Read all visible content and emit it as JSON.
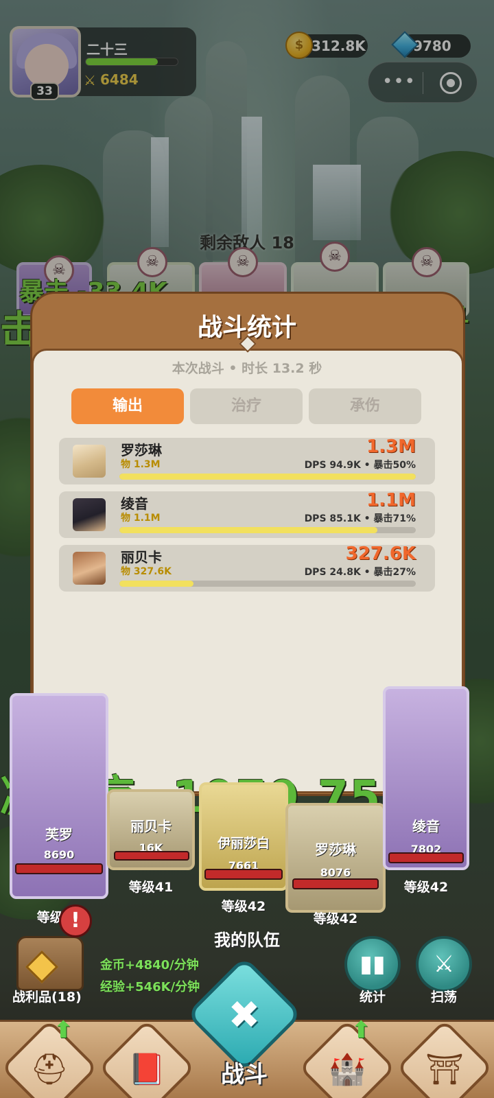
{
  "player": {
    "name": "二十三",
    "level": "33",
    "xp_fraction": 0.78,
    "power": "6484"
  },
  "currency": {
    "gold": "312.8K",
    "gems": "9780"
  },
  "battle": {
    "enemies_remaining": "剩余敌人 18",
    "float_crit": "暴击 -33.4K",
    "float_left": "击",
    "float_right": "71",
    "float_bottom": "减治疗 -1070.75"
  },
  "modal": {
    "title": "战斗统计",
    "subtitle": "本次战斗 • 时长 13.2 秒",
    "tabs": [
      {
        "label": "输出",
        "active": true
      },
      {
        "label": "治疗",
        "active": false
      },
      {
        "label": "承伤",
        "active": false
      }
    ],
    "rows": [
      {
        "name": "罗莎琳",
        "phys": "物 1.3M",
        "total": "1.3M",
        "stats": "DPS 94.9K • 暴击50%",
        "fraction": 1.0
      },
      {
        "name": "绫音",
        "phys": "物 1.1M",
        "total": "1.1M",
        "stats": "DPS 85.1K • 暴击71%",
        "fraction": 0.87
      },
      {
        "name": "丽贝卡",
        "phys": "物 327.6K",
        "total": "327.6K",
        "stats": "DPS 24.8K • 暴击27%",
        "fraction": 0.25
      }
    ]
  },
  "team": {
    "label": "我的队伍",
    "members": [
      {
        "name": "芙罗",
        "hp": "8690",
        "level": "等级41"
      },
      {
        "name": "丽贝卡",
        "hp": "16K",
        "level": "等级41"
      },
      {
        "name": "伊丽莎白",
        "hp": "7661",
        "level": "等级42"
      },
      {
        "name": "罗莎琳",
        "hp": "8076",
        "level": "等级42"
      },
      {
        "name": "绫音",
        "hp": "7802",
        "level": "等级42"
      }
    ]
  },
  "loot": {
    "label": "战利品(18)",
    "alert": "!",
    "gold_rate": "金币+4840/分钟",
    "exp_rate": "经验+546K/分钟"
  },
  "buttons": {
    "stats": "统计",
    "sweep": "扫荡"
  },
  "nav": {
    "battle": "战斗"
  },
  "colors": {
    "accent_orange": "#f28b3a",
    "damage_text": "#f0672c",
    "bar_yellow": "#f2e05e",
    "hp_red": "#c22a2a"
  }
}
